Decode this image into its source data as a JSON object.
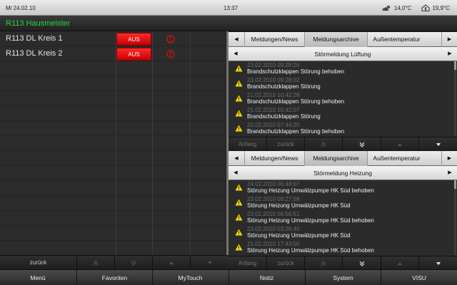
{
  "statusbar": {
    "date": "Mi 24.02.10",
    "time": "13:37",
    "outdoor_temp": "14,0°C",
    "indoor_temp": "19,9°C",
    "outdoor_icon": "cloud-sun-icon",
    "indoor_icon": "thermometer-house-icon"
  },
  "title": "R113 Hausmeister",
  "devices": [
    {
      "label": "R113 DL Kreis 1",
      "state": "AUS",
      "icon": "warning-circle-icon"
    },
    {
      "label": "R113 DL Kreis 2",
      "state": "AUS",
      "icon": "warning-circle-icon"
    }
  ],
  "left_nav": {
    "back": "zurück"
  },
  "panel1": {
    "tabs": [
      "Meldungen/News",
      "Meldungsarchive",
      "Außentemperatur"
    ],
    "active_tab": 1,
    "subtitle": "Störmeldung Lüftung",
    "messages": [
      {
        "ts": "23.02.2010 09:28:26",
        "text": "Brandschutzklappen Störung behoben"
      },
      {
        "ts": "23.02.2010 09:28:02",
        "text": "Brandschutzklappen Störung"
      },
      {
        "ts": "21.02.2010 10:42:28",
        "text": "Brandschutzklappen Störung behoben"
      },
      {
        "ts": "21.02.2010 10:42:07",
        "text": "Brandschutzklappen Störung"
      },
      {
        "ts": "20.02.2010 07:44:20",
        "text": "Brandschutzklappen Störung behoben"
      }
    ],
    "nav": {
      "start": "Anfang",
      "back": "zurück"
    }
  },
  "panel2": {
    "tabs": [
      "Meldungen/News",
      "Meldungsarchive",
      "Außentemperatur"
    ],
    "active_tab": 1,
    "subtitle": "Störmeldung Heizung",
    "messages": [
      {
        "ts": "24.02.2010 06:48:07",
        "text": "Störung Heizung Umwälzpumpe HK Süd behoben"
      },
      {
        "ts": "23.02.2010 09:27:58",
        "text": "Störung Heizung Umwälzpumpe HK Süd"
      },
      {
        "ts": "23.02.2010 06:56:51",
        "text": "Störung Heizung Umwälzpumpe HK Süd behoben"
      },
      {
        "ts": "23.02.2010 03:26:40",
        "text": "Störung Heizung Umwälzpumpe HK Süd"
      },
      {
        "ts": "21.02.2010 17:43:50",
        "text": "Störung Heizung Umwälzpumpe HK Süd behoben"
      }
    ],
    "nav": {
      "start": "Anfang",
      "back": "zurück"
    }
  },
  "menu": [
    "Menü",
    "Favoriten",
    "MyTouch",
    "Notiz",
    "System",
    "VISU"
  ],
  "colors": {
    "title": "#25d63a",
    "off_button": "#e00000",
    "warning": "#ffd800"
  }
}
